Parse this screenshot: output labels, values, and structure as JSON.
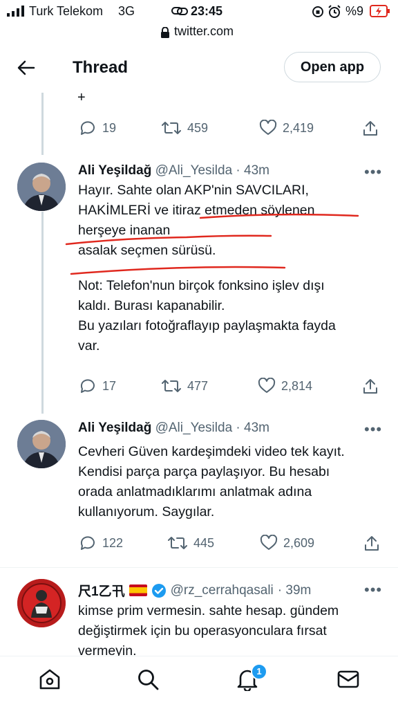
{
  "status_bar": {
    "carrier": "Turk Telekom",
    "network": "3G",
    "time": "23:45",
    "battery": "%9"
  },
  "browser": {
    "url": "twitter.com"
  },
  "header": {
    "title": "Thread",
    "open_app_label": "Open app"
  },
  "top_fragment": {
    "text": "+",
    "replies": "19",
    "retweets": "459",
    "likes": "2,419"
  },
  "tweets": [
    {
      "name": "Ali Yeşildağ",
      "handle": "@Ali_Yesilda",
      "time": "· 43m",
      "lines": [
        "Hayır. Sahte olan AKP'nin SAVCILARI,",
        "HAKİMLERİ ve itiraz etmeden söylenen",
        "herşeye inanan",
        "asalak seçmen sürüsü.",
        "",
        "Not: Telefon'nun birçok fonksino işlev dışı",
        "kaldı. Burası kapanabilir.",
        "Bu yazıları fotoğraflayıp paylaşmakta fayda",
        "var."
      ],
      "replies": "17",
      "retweets": "477",
      "likes": "2,814"
    },
    {
      "name": "Ali Yeşildağ",
      "handle": "@Ali_Yesilda",
      "time": "· 43m",
      "lines": [
        "Cevheri Güven kardeşimdeki video tek kayıt.",
        "Kendisi parça parça paylaşıyor. Bu hesabı",
        "orada anlatmadıklarımı anlatmak adına",
        "kullanıyorum. Saygılar."
      ],
      "replies": "122",
      "retweets": "445",
      "likes": "2,609"
    },
    {
      "name": "尺1乙卂",
      "flag": "🇪🇸",
      "handle": "@rz_cerrahqasali",
      "time": "· 39m",
      "lines": [
        "kimse prim vermesin. sahte hesap. gündem",
        "değiştirmek için bu operasyonculara fırsat",
        "vermeyin."
      ]
    }
  ],
  "more_label": "•••",
  "nav": {
    "notification_count": "1"
  },
  "colors": {
    "accent": "#1d9bf0",
    "muted": "#536471",
    "annotation": "#e0281e"
  }
}
